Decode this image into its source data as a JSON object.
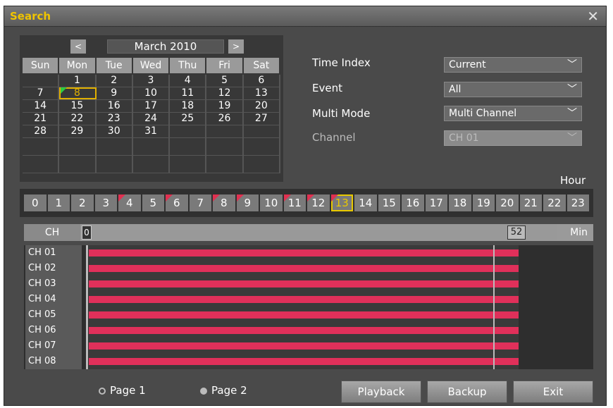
{
  "window": {
    "title": "Search",
    "close_glyph": "✕"
  },
  "calendar": {
    "month": "March 2010",
    "prev_glyph": "<",
    "next_glyph": ">",
    "dow": [
      "Sun",
      "Mon",
      "Tue",
      "Wed",
      "Thu",
      "Fri",
      "Sat"
    ],
    "weeks": [
      [
        "",
        "1",
        "2",
        "3",
        "4",
        "5",
        "6"
      ],
      [
        "7",
        "8",
        "9",
        "10",
        "11",
        "12",
        "13"
      ],
      [
        "14",
        "15",
        "16",
        "17",
        "18",
        "19",
        "20"
      ],
      [
        "21",
        "22",
        "23",
        "24",
        "25",
        "26",
        "27"
      ],
      [
        "28",
        "29",
        "30",
        "31",
        "",
        "",
        ""
      ]
    ],
    "selected_day": "8"
  },
  "options": {
    "time_index_label": "Time Index",
    "time_index_value": "Current",
    "event_label": "Event",
    "event_value": "All",
    "multi_mode_label": "Multi Mode",
    "multi_mode_value": "Multi Channel",
    "channel_label": "Channel",
    "channel_value": "CH 01"
  },
  "hour_label": "Hour",
  "hours": [
    "0",
    "1",
    "2",
    "3",
    "4",
    "5",
    "6",
    "7",
    "8",
    "9",
    "10",
    "11",
    "12",
    "13",
    "14",
    "15",
    "16",
    "17",
    "18",
    "19",
    "20",
    "21",
    "22",
    "23"
  ],
  "hours_with_recording": [
    "4",
    "6",
    "8",
    "9",
    "11",
    "12",
    "13"
  ],
  "selected_hour": "13",
  "timeline": {
    "ch_label": "CH",
    "start_marker": "0",
    "end_marker": "52",
    "min_label": "Min",
    "channels": [
      "CH 01",
      "CH 02",
      "CH 03",
      "CH 04",
      "CH 05",
      "CH 06",
      "CH 07",
      "CH 08"
    ]
  },
  "pages": {
    "page1": "Page 1",
    "page2": "Page 2",
    "selected": "Page 1"
  },
  "buttons": {
    "playback": "Playback",
    "backup": "Backup",
    "exit": "Exit"
  },
  "colors": {
    "recording": "#e0305a",
    "title": "#f0c400",
    "highlight": "#e8c800"
  }
}
